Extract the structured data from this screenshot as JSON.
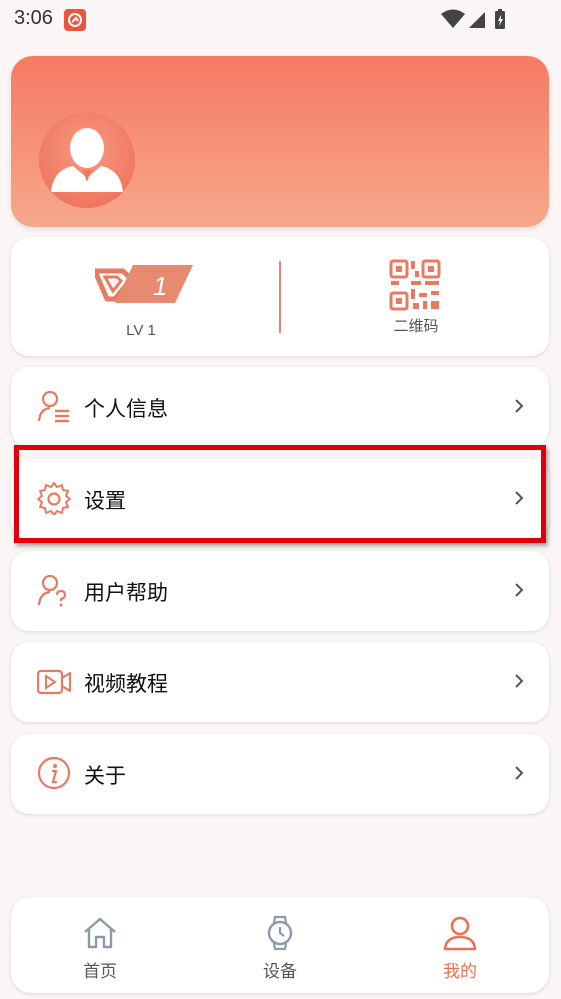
{
  "status_bar": {
    "time": "3:06"
  },
  "profile": {},
  "level": {
    "label": "LV 1",
    "badge_number": "1"
  },
  "qr": {
    "label": "二维码"
  },
  "menu": [
    {
      "label": "个人信息",
      "icon": "user-info-icon"
    },
    {
      "label": "设置",
      "icon": "gear-icon"
    },
    {
      "label": "用户帮助",
      "icon": "user-help-icon"
    },
    {
      "label": "视频教程",
      "icon": "video-icon"
    },
    {
      "label": "关于",
      "icon": "info-icon"
    }
  ],
  "nav": [
    {
      "label": "首页",
      "icon": "home-icon",
      "active": false
    },
    {
      "label": "设备",
      "icon": "watch-icon",
      "active": false
    },
    {
      "label": "我的",
      "icon": "profile-icon",
      "active": true
    }
  ],
  "colors": {
    "accent": "#ec6f56",
    "highlight": "#e0000a",
    "background": "#fbf6f6"
  }
}
